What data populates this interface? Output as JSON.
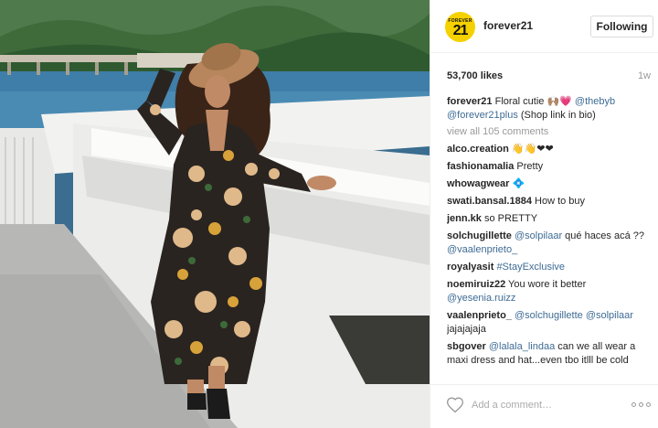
{
  "header": {
    "avatar_small": "FOREVER",
    "avatar_big": "21",
    "username": "forever21",
    "follow_label": "Following"
  },
  "stats": {
    "likes": "53,700 likes",
    "ago": "1w"
  },
  "caption": {
    "user": "forever21",
    "text": "Floral cutie 🙌🏽💗",
    "mention1": "@thebyb",
    "mention2": "@forever21plus",
    "text2": "(Shop link in bio)"
  },
  "view_all": "view all 105 comments",
  "comments": [
    {
      "user": "alco.creation",
      "parts": [
        {
          "t": " 👋👋❤❤",
          "link": false
        }
      ]
    },
    {
      "user": "fashionamalia",
      "parts": [
        {
          "t": " Pretty",
          "link": false
        }
      ]
    },
    {
      "user": "whowagwear",
      "parts": [
        {
          "t": " 💠",
          "link": false
        }
      ]
    },
    {
      "user": "swati.bansal.1884",
      "parts": [
        {
          "t": " How to buy",
          "link": false
        }
      ]
    },
    {
      "user": "jenn.kk",
      "parts": [
        {
          "t": " so PRETTY",
          "link": false
        }
      ]
    },
    {
      "user": "solchugillette",
      "parts": [
        {
          "t": " ",
          "link": false
        },
        {
          "t": "@solpilaar",
          "link": true
        },
        {
          "t": " qué haces acá ?? ",
          "link": false
        },
        {
          "t": "@vaalenprieto_",
          "link": true
        }
      ]
    },
    {
      "user": "royalyasit",
      "parts": [
        {
          "t": " ",
          "link": false
        },
        {
          "t": "#StayExclusive",
          "link": true
        }
      ]
    },
    {
      "user": "noemiruiz22",
      "parts": [
        {
          "t": " You wore it better ",
          "link": false
        },
        {
          "t": "@yesenia.ruizz",
          "link": true
        }
      ]
    },
    {
      "user": "vaalenprieto_",
      "parts": [
        {
          "t": " ",
          "link": false
        },
        {
          "t": "@solchugillette",
          "link": true
        },
        {
          "t": " ",
          "link": false
        },
        {
          "t": "@solpilaar",
          "link": true
        },
        {
          "t": " jajajajaja",
          "link": false
        }
      ]
    },
    {
      "user": "sbgover",
      "parts": [
        {
          "t": " ",
          "link": false
        },
        {
          "t": "@lalala_lindaa",
          "link": true
        },
        {
          "t": " can we all wear a maxi dress and hat...even tbo itlll be cold",
          "link": false
        }
      ]
    }
  ],
  "add_comment": {
    "placeholder": "Add a comment…"
  },
  "icons": {
    "heart": "heart-icon",
    "more": "more-options-icon"
  },
  "colors": {
    "link": "#3e6b95",
    "avatar_bg": "#f5d100"
  }
}
